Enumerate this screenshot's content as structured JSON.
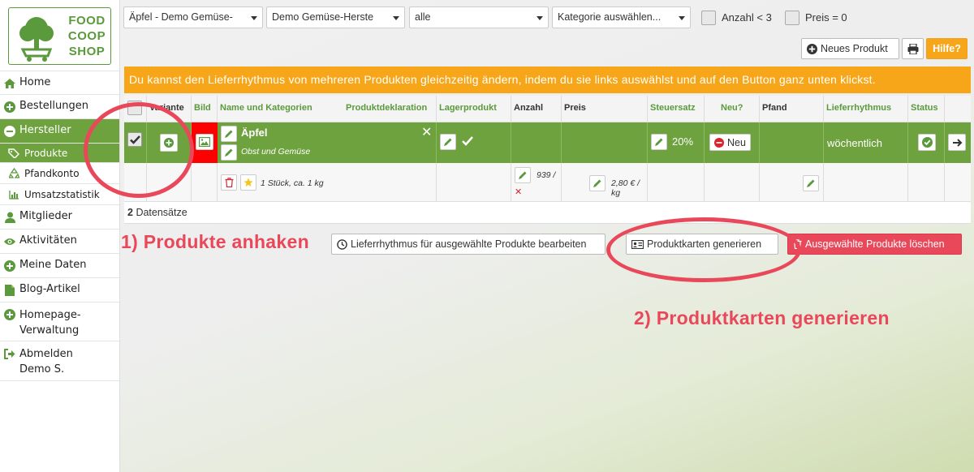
{
  "logo": {
    "line1": "FOOD",
    "line2": "COOP",
    "line3": "SHOP"
  },
  "sidebar": {
    "items": [
      {
        "label": "Home",
        "icon": "home-icon"
      },
      {
        "label": "Bestellungen",
        "icon": "plus-circle-icon"
      },
      {
        "label": "Hersteller",
        "icon": "minus-circle-icon",
        "active": true
      },
      {
        "label": "Produkte",
        "icon": "tags-icon",
        "sub": true,
        "active": true
      },
      {
        "label": "Pfandkonto",
        "icon": "recycle-icon",
        "sub": true
      },
      {
        "label": "Umsatzstatistik",
        "icon": "bar-chart-icon",
        "sub": true
      },
      {
        "label": "Mitglieder",
        "icon": "user-icon"
      },
      {
        "label": "Aktivitäten",
        "icon": "eye-icon"
      },
      {
        "label": "Meine Daten",
        "icon": "plus-circle-icon"
      },
      {
        "label": "Blog-Artikel",
        "icon": "file-icon"
      },
      {
        "label_line1": "Homepage-",
        "label_line2": "Verwaltung",
        "icon": "plus-circle-icon"
      },
      {
        "label_line1": "Abmelden",
        "label_line2": "Demo S.",
        "icon": "sign-out-icon"
      }
    ]
  },
  "filters": {
    "product": "Äpfel - Demo Gemüse-",
    "manufacturer": "Demo Gemüse-Herste",
    "status": "alle",
    "category": "Kategorie auswählen...",
    "check_anzahl": "Anzahl < 3",
    "check_preis": "Preis = 0"
  },
  "toolbar": {
    "new_product": "Neues Produkt",
    "help": "Hilfe?"
  },
  "notice": "Du kannst den Lieferrhythmus von mehreren Produkten gleichzeitig ändern, indem du sie links auswählst und auf den Button ganz unten klickst.",
  "table": {
    "headers": [
      "Variante",
      "Bild",
      "Name und Kategorien",
      "Produktdeklaration",
      "Lagerprodukt",
      "Anzahl",
      "Preis",
      "Steuersatz",
      "Neu?",
      "Pfand",
      "Lieferrhythmus",
      "Status"
    ],
    "product": {
      "name": "Äpfel",
      "category": "Obst und Gemüse",
      "tax": "20%",
      "new_label": "Neu",
      "delivery": "wöchentlich"
    },
    "variant": {
      "unit": "1 Stück, ca. 1 kg",
      "amount": "939 /",
      "price": "2,80 € / kg"
    },
    "count_num": "2",
    "count_label": "Datensätze"
  },
  "actions": {
    "delivery_rhythm": "Lieferrhythmus für ausgewählte Produkte bearbeiten",
    "product_cards": "Produktkarten generieren",
    "delete_selected": "Ausgewählte Produkte löschen"
  },
  "annotations": {
    "step1": "1) Produkte anhaken",
    "step2": "2) Produktkarten generieren"
  },
  "colors": {
    "green": "#6ea23f",
    "orange": "#f7a61a",
    "red": "#e8485a",
    "bild_red": "#ff0000"
  }
}
